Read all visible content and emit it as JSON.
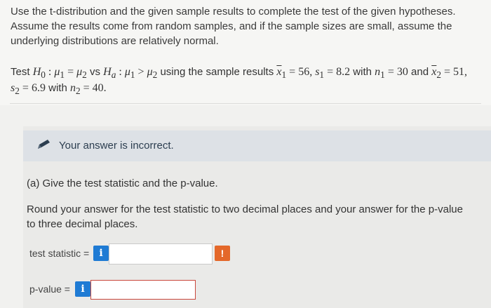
{
  "instructions": "Use the t-distribution and the given sample results to complete the test of the given hypotheses. Assume the results come from random samples, and if the sample sizes are small, assume the underlying distributions are relatively normal.",
  "problem": {
    "test_word": "Test",
    "vs": "vs",
    "using": "using the sample results",
    "with": "with",
    "and": "and",
    "x1bar": "56",
    "s1": "8.2",
    "n1": "30",
    "x2bar": "51",
    "s2": "6.9",
    "n2": "40"
  },
  "feedback": {
    "message": "Your answer is incorrect.",
    "icon": "pencil-icon"
  },
  "part_a": {
    "title": "(a) Give the test statistic and the p-value.",
    "instructions": "Round your answer for the test statistic to two decimal places and your answer for the p-value to three decimal places."
  },
  "fields": {
    "test_statistic": {
      "label": "test statistic =",
      "value": "",
      "info_icon": "i",
      "warning_icon": "!"
    },
    "p_value": {
      "label": "p-value =",
      "value": "",
      "info_icon": "i"
    }
  },
  "colors": {
    "info_button": "#1f7bd4",
    "warning_button": "#e4682a",
    "error_border": "#c9473c",
    "feedback_banner": "#dde1e6"
  }
}
